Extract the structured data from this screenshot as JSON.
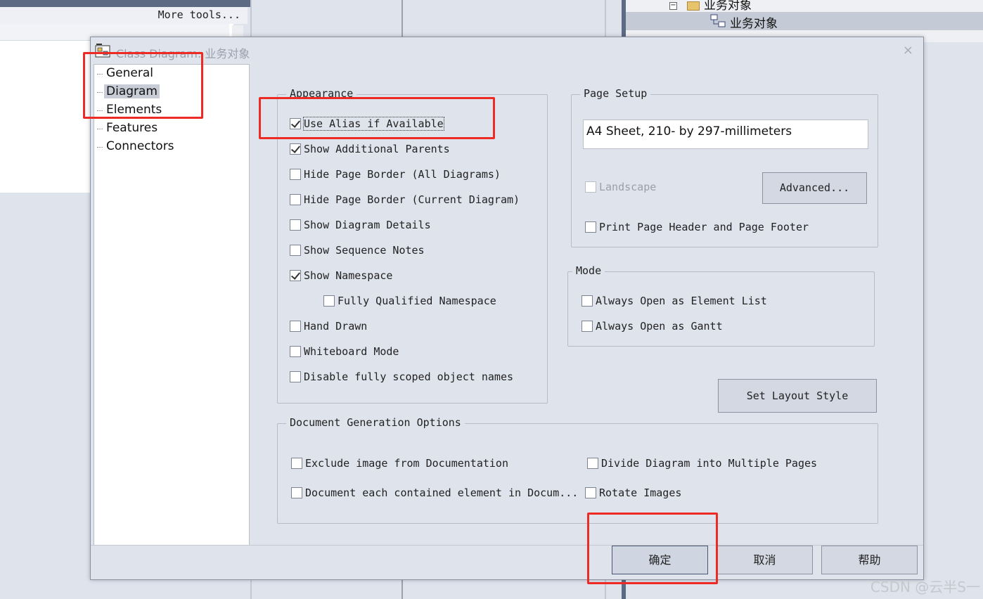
{
  "background": {
    "more_tools": "More tools...",
    "tree_parent": "业务对象",
    "tree_selected": "业务对象"
  },
  "dialog": {
    "title": "Class Diagram: 业务对象",
    "close": "×",
    "nav": [
      "General",
      "Diagram",
      "Elements",
      "Features",
      "Connectors"
    ],
    "nav_selected": "Diagram",
    "appearance": {
      "title": "Appearance",
      "options": [
        {
          "label": "Use Alias if Available",
          "checked": true
        },
        {
          "label": "Show Additional Parents",
          "checked": true
        },
        {
          "label": "Hide Page Border (All Diagrams)",
          "checked": false
        },
        {
          "label": "Hide Page Border (Current Diagram)",
          "checked": false
        },
        {
          "label": "Show Diagram Details",
          "checked": false
        },
        {
          "label": "Show Sequence Notes",
          "checked": false
        },
        {
          "label": "Show Namespace",
          "checked": true
        },
        {
          "label": "Fully Qualified Namespace",
          "checked": false
        },
        {
          "label": "Hand Drawn",
          "checked": false
        },
        {
          "label": "Whiteboard Mode",
          "checked": false
        },
        {
          "label": "Disable fully scoped object names",
          "checked": false
        }
      ]
    },
    "page_setup": {
      "title": "Page Setup",
      "paper": "A4 Sheet, 210- by 297-millimeters",
      "landscape": "Landscape",
      "advanced": "Advanced...",
      "print_header_footer": "Print Page Header and Page Footer"
    },
    "mode": {
      "title": "Mode",
      "element_list": "Always Open as Element List",
      "gantt": "Always Open as Gantt"
    },
    "set_layout_style": "Set Layout Style",
    "doc_gen": {
      "title": "Document Generation Options",
      "exclude_image": "Exclude image from Documentation",
      "divide_pages": "Divide Diagram into Multiple Pages",
      "document_each": "Document each contained element in Docum...",
      "rotate_images": "Rotate Images"
    },
    "buttons": {
      "ok": "确定",
      "cancel": "取消",
      "help": "帮助"
    }
  },
  "watermark": "CSDN @云半S一"
}
